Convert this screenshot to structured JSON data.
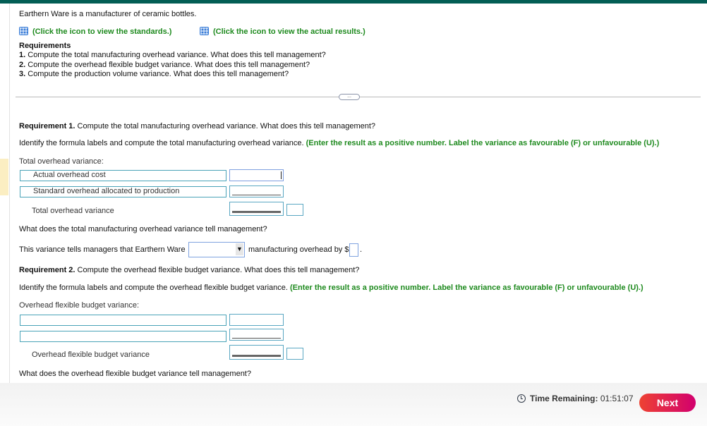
{
  "intro": "Earthern Ware is a manufacturer of ceramic bottles.",
  "links": {
    "standards": "(Click the icon to view the standards.)",
    "actual": "(Click the icon to view the actual results.)",
    "icon": "grid-table-icon"
  },
  "requirements": {
    "title": "Requirements",
    "items": [
      {
        "num": "1.",
        "text": " Compute the total manufacturing overhead variance. What does this tell management?"
      },
      {
        "num": "2.",
        "text": " Compute the overhead flexible budget variance. What does this tell management?"
      },
      {
        "num": "3.",
        "text": " Compute the production volume variance. What does this tell management?"
      }
    ]
  },
  "divider_pill": "...",
  "req1": {
    "head": "Requirement 1.",
    "text": " Compute the total manufacturing overhead variance. What does this tell management?",
    "identify": "Identify the formula labels and compute the total manufacturing overhead variance. ",
    "instruction": "(Enter the result as a positive number. Label the variance as favourable (F) or unfavourable (U).)",
    "table_title": "Total overhead variance:",
    "row1_label": "Actual overhead cost",
    "row2_label": "Standard overhead allocated to production",
    "total_label": "Total overhead variance",
    "question": "What does the total manufacturing overhead variance tell management?",
    "sentence_a": "This variance tells managers that Earthern Ware",
    "sentence_b": "manufacturing overhead by $",
    "sentence_c": ".",
    "select_value": ""
  },
  "req2": {
    "head": "Requirement 2.",
    "text": " Compute the overhead flexible budget variance. What does this tell management?",
    "identify": "Identify the formula labels and compute the overhead flexible budget variance. ",
    "instruction": "(Enter the result as a positive number. Label the variance as favourable (F) or unfavourable (U).)",
    "table_title": "Overhead flexible budget variance:",
    "row1_label": "",
    "row2_label": "",
    "total_label": "Overhead flexible budget variance",
    "question": "What does the overhead flexible budget variance tell management?"
  },
  "footer": {
    "time_label": "Time Remaining:",
    "time_value": "01:51:07",
    "next": "Next"
  },
  "colors": {
    "topbar": "#035e55",
    "green": "#1e8a1e",
    "next_start": "#ee4232",
    "next_end": "#d2006e"
  }
}
